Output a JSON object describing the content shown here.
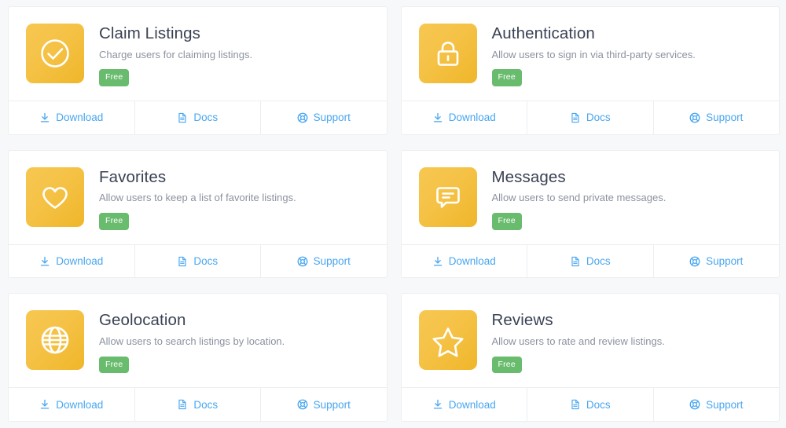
{
  "theme": {
    "page_background": "#f7f8f9",
    "card_background": "#ffffff",
    "card_border": "#eceef0",
    "icon_tile_color": "#f5c246",
    "icon_tile_color_dark": "#efb629",
    "badge_color": "#69bb6d",
    "link_color": "#48a6f0",
    "title_color": "#3b4254",
    "description_color": "#8b929e"
  },
  "actions": {
    "download": {
      "label": "Download",
      "icon": "download-icon"
    },
    "docs": {
      "label": "Docs",
      "icon": "document-icon"
    },
    "support": {
      "label": "Support",
      "icon": "lifebuoy-icon"
    }
  },
  "cards": [
    {
      "id": "claim-listings",
      "title": "Claim Listings",
      "description": "Charge users for claiming listings.",
      "badge": "Free",
      "icon": "check-circle-icon"
    },
    {
      "id": "authentication",
      "title": "Authentication",
      "description": "Allow users to sign in via third-party services.",
      "badge": "Free",
      "icon": "lock-icon"
    },
    {
      "id": "favorites",
      "title": "Favorites",
      "description": "Allow users to keep a list of favorite listings.",
      "badge": "Free",
      "icon": "heart-icon"
    },
    {
      "id": "messages",
      "title": "Messages",
      "description": "Allow users to send private messages.",
      "badge": "Free",
      "icon": "chat-bubble-icon"
    },
    {
      "id": "geolocation",
      "title": "Geolocation",
      "description": "Allow users to search listings by location.",
      "badge": "Free",
      "icon": "globe-icon"
    },
    {
      "id": "reviews",
      "title": "Reviews",
      "description": "Allow users to rate and review listings.",
      "badge": "Free",
      "icon": "star-icon"
    }
  ]
}
